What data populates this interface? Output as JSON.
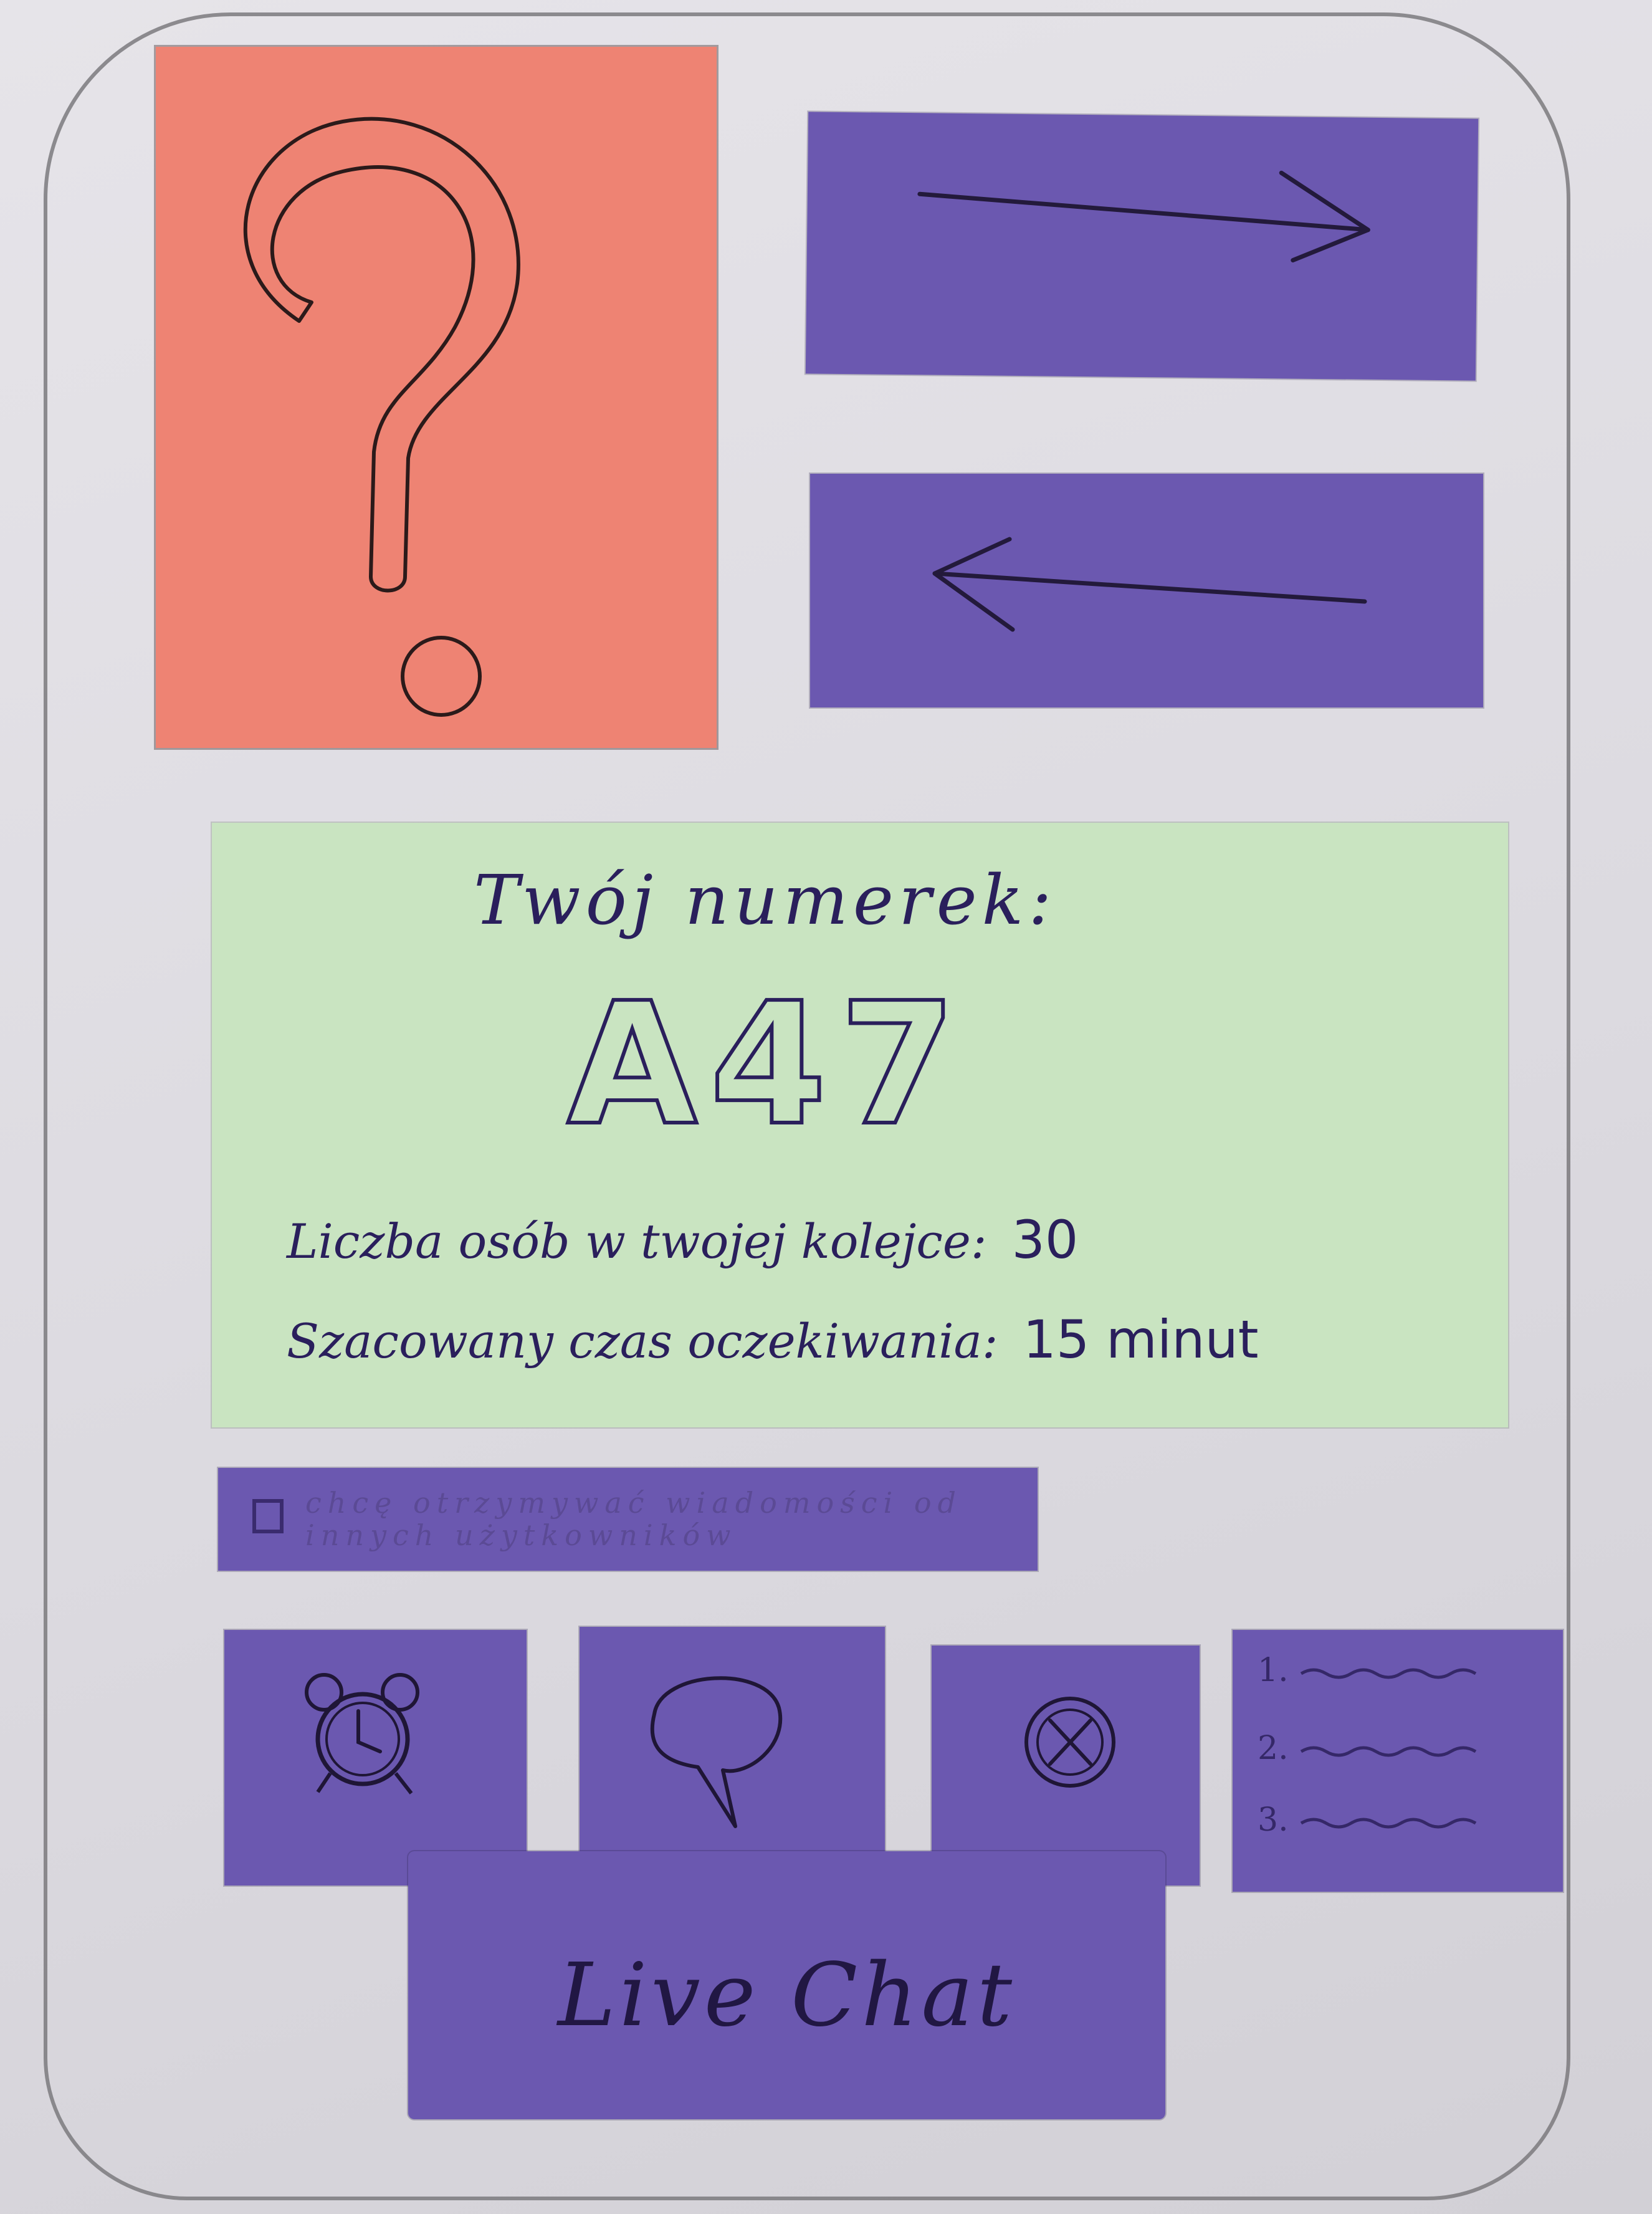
{
  "colors": {
    "paper": "#dcdae0",
    "help_card": "#ee8373",
    "button_purple": "#6b58b0",
    "ticket_card": "#c9e4c1",
    "ink": "#2a1f5c"
  },
  "help": {
    "icon": "question-mark-icon"
  },
  "navigation": {
    "next_icon": "arrow-right-icon",
    "back_icon": "arrow-left-icon"
  },
  "ticket": {
    "title": "Twój numerek:",
    "number": "A47",
    "queue_label": "Liczba osób w twojej kolejce:",
    "queue_value": "30",
    "wait_label": "Szacowany czas oczekiwania:",
    "wait_value": "15 minut"
  },
  "notifications": {
    "checked": false,
    "label": "chcę otrzymywać wiadomości od innych użytkowników"
  },
  "actions": [
    {
      "icon": "alarm-clock-icon"
    },
    {
      "icon": "speech-bubble-icon"
    },
    {
      "icon": "cancel-circle-icon"
    },
    {
      "icon": "numbered-list-icon",
      "items": [
        "1.",
        "2.",
        "3."
      ]
    }
  ],
  "live_chat": {
    "label": "Live Chat"
  }
}
